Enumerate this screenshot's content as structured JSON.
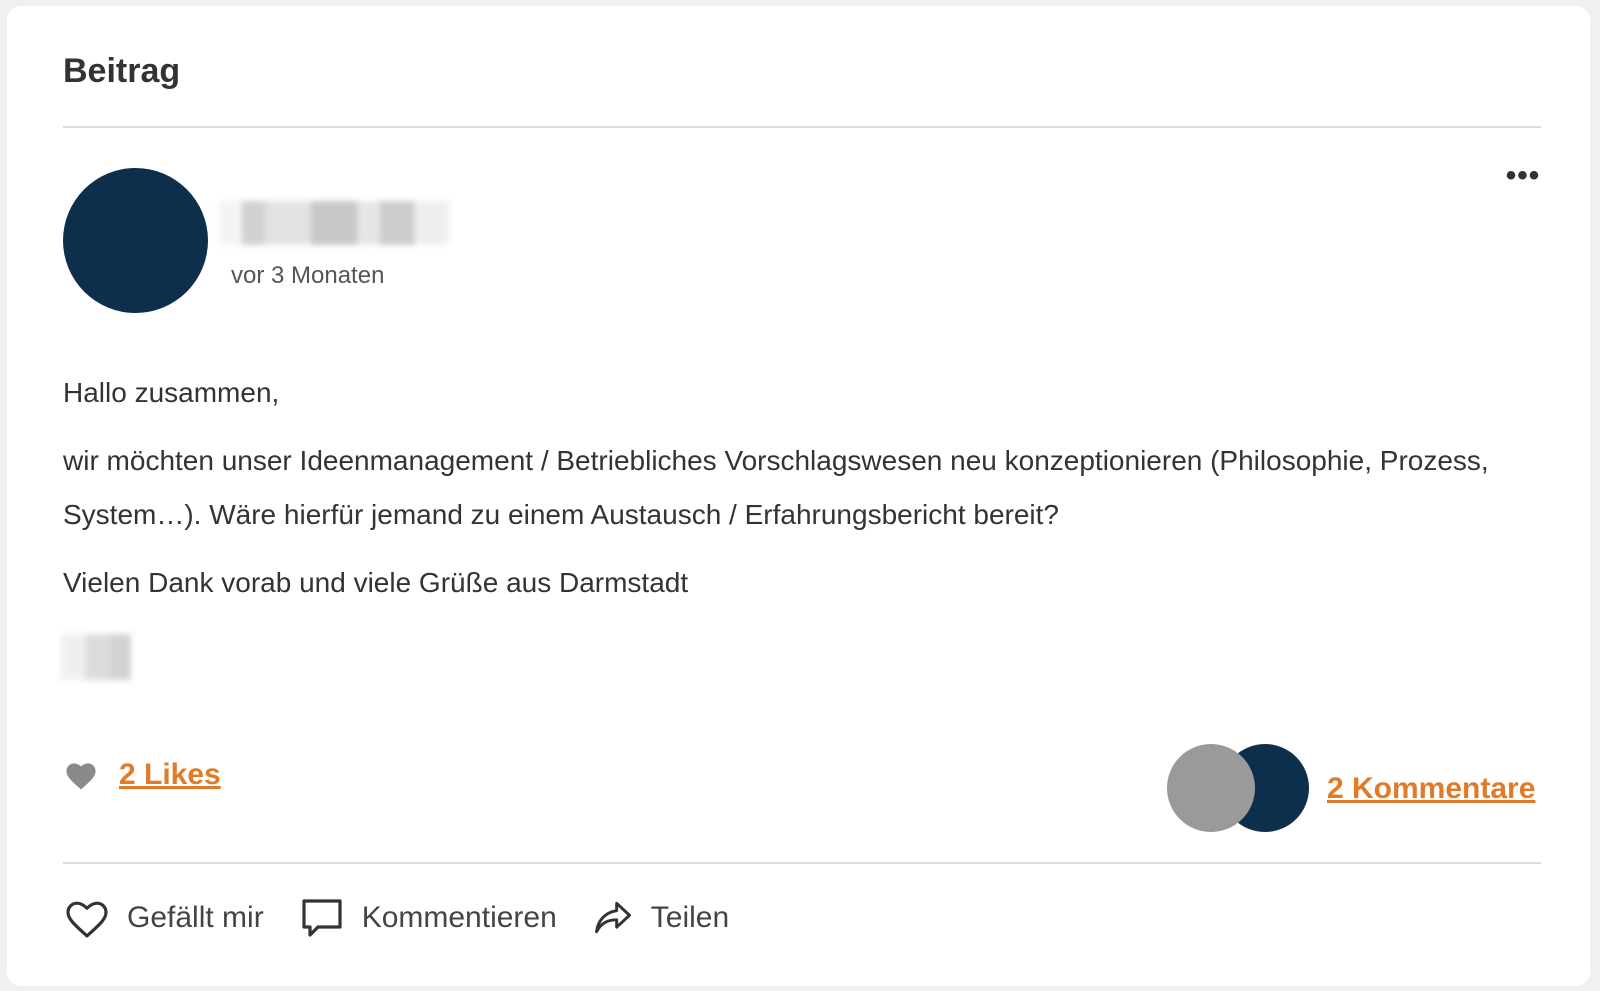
{
  "card": {
    "title": "Beitrag"
  },
  "post": {
    "timestamp": "vor 3 Monaten",
    "more_label": "•••",
    "greeting": "Hallo zusammen,",
    "body": "wir möchten unser Ideenmanagement / Betriebliches Vorschlagswesen neu konzeptionieren (Philosophie, Prozess, System…). Wäre hierfür jemand zu einem Austausch / Erfahrungsbericht bereit?",
    "closing": "Vielen Dank vorab und viele Grüße aus Darmstadt"
  },
  "stats": {
    "likes_label": "2 Likes",
    "comments_label": "2 Kommentare"
  },
  "actions": {
    "like_label": "Gefällt mir",
    "comment_label": "Kommentieren",
    "share_label": "Teilen"
  },
  "colors": {
    "accent": "#e07b2a",
    "avatar": "#0e2f4b",
    "avatar_secondary": "#9a9a9a"
  },
  "icons": {
    "likes": "heart-filled-icon",
    "like_action": "heart-outline-icon",
    "comment_action": "speech-bubble-icon",
    "share_action": "share-arrow-icon",
    "more": "more-dots-icon"
  }
}
